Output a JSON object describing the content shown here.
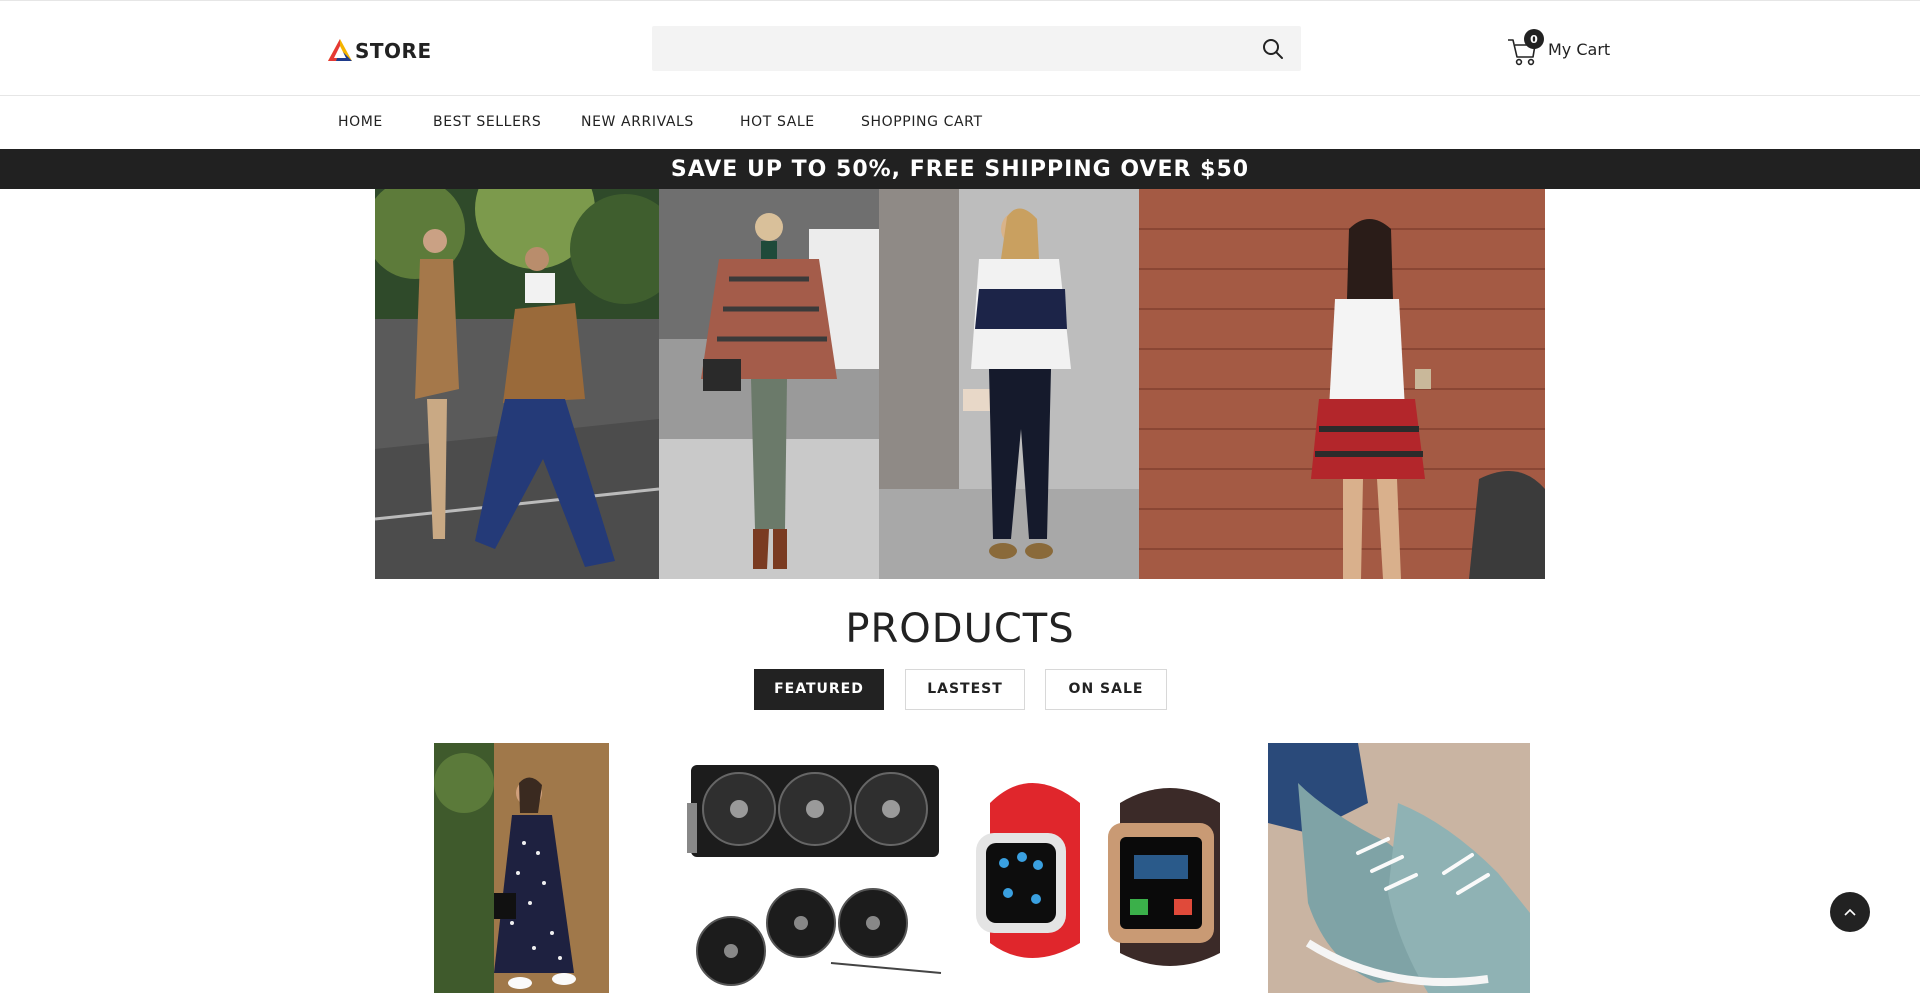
{
  "brand": {
    "logo_text": "STORE",
    "colors": {
      "logo_red": "#e53935",
      "logo_blue": "#1e3a8a",
      "logo_yellow": "#f5b400",
      "dark": "#212121"
    }
  },
  "search": {
    "value": "",
    "placeholder": "",
    "icon": "search-icon"
  },
  "cart": {
    "count": "0",
    "label": "My Cart",
    "icon": "cart-icon"
  },
  "nav": {
    "items": [
      "HOME",
      "BEST SELLERS",
      "NEW ARRIVALS",
      "HOT SALE",
      "SHOPPING CART"
    ]
  },
  "promo": {
    "text": "SAVE UP TO 50%, FREE SHIPPING OVER $50"
  },
  "banner": {
    "panels": [
      "street-style-photo-1",
      "street-style-photo-2",
      "street-style-photo-3",
      "street-style-photo-4"
    ]
  },
  "products": {
    "title": "PRODUCTS",
    "tabs": [
      {
        "label": "FEATURED",
        "active": true
      },
      {
        "label": "LASTEST",
        "active": false
      },
      {
        "label": "ON SALE",
        "active": false
      }
    ],
    "items": [
      "polka-dot-dress-photo",
      "graphics-card-photo",
      "smartwatch-photo",
      "lace-sneakers-photo"
    ]
  },
  "back_to_top": {
    "icon": "chevron-up-icon"
  }
}
